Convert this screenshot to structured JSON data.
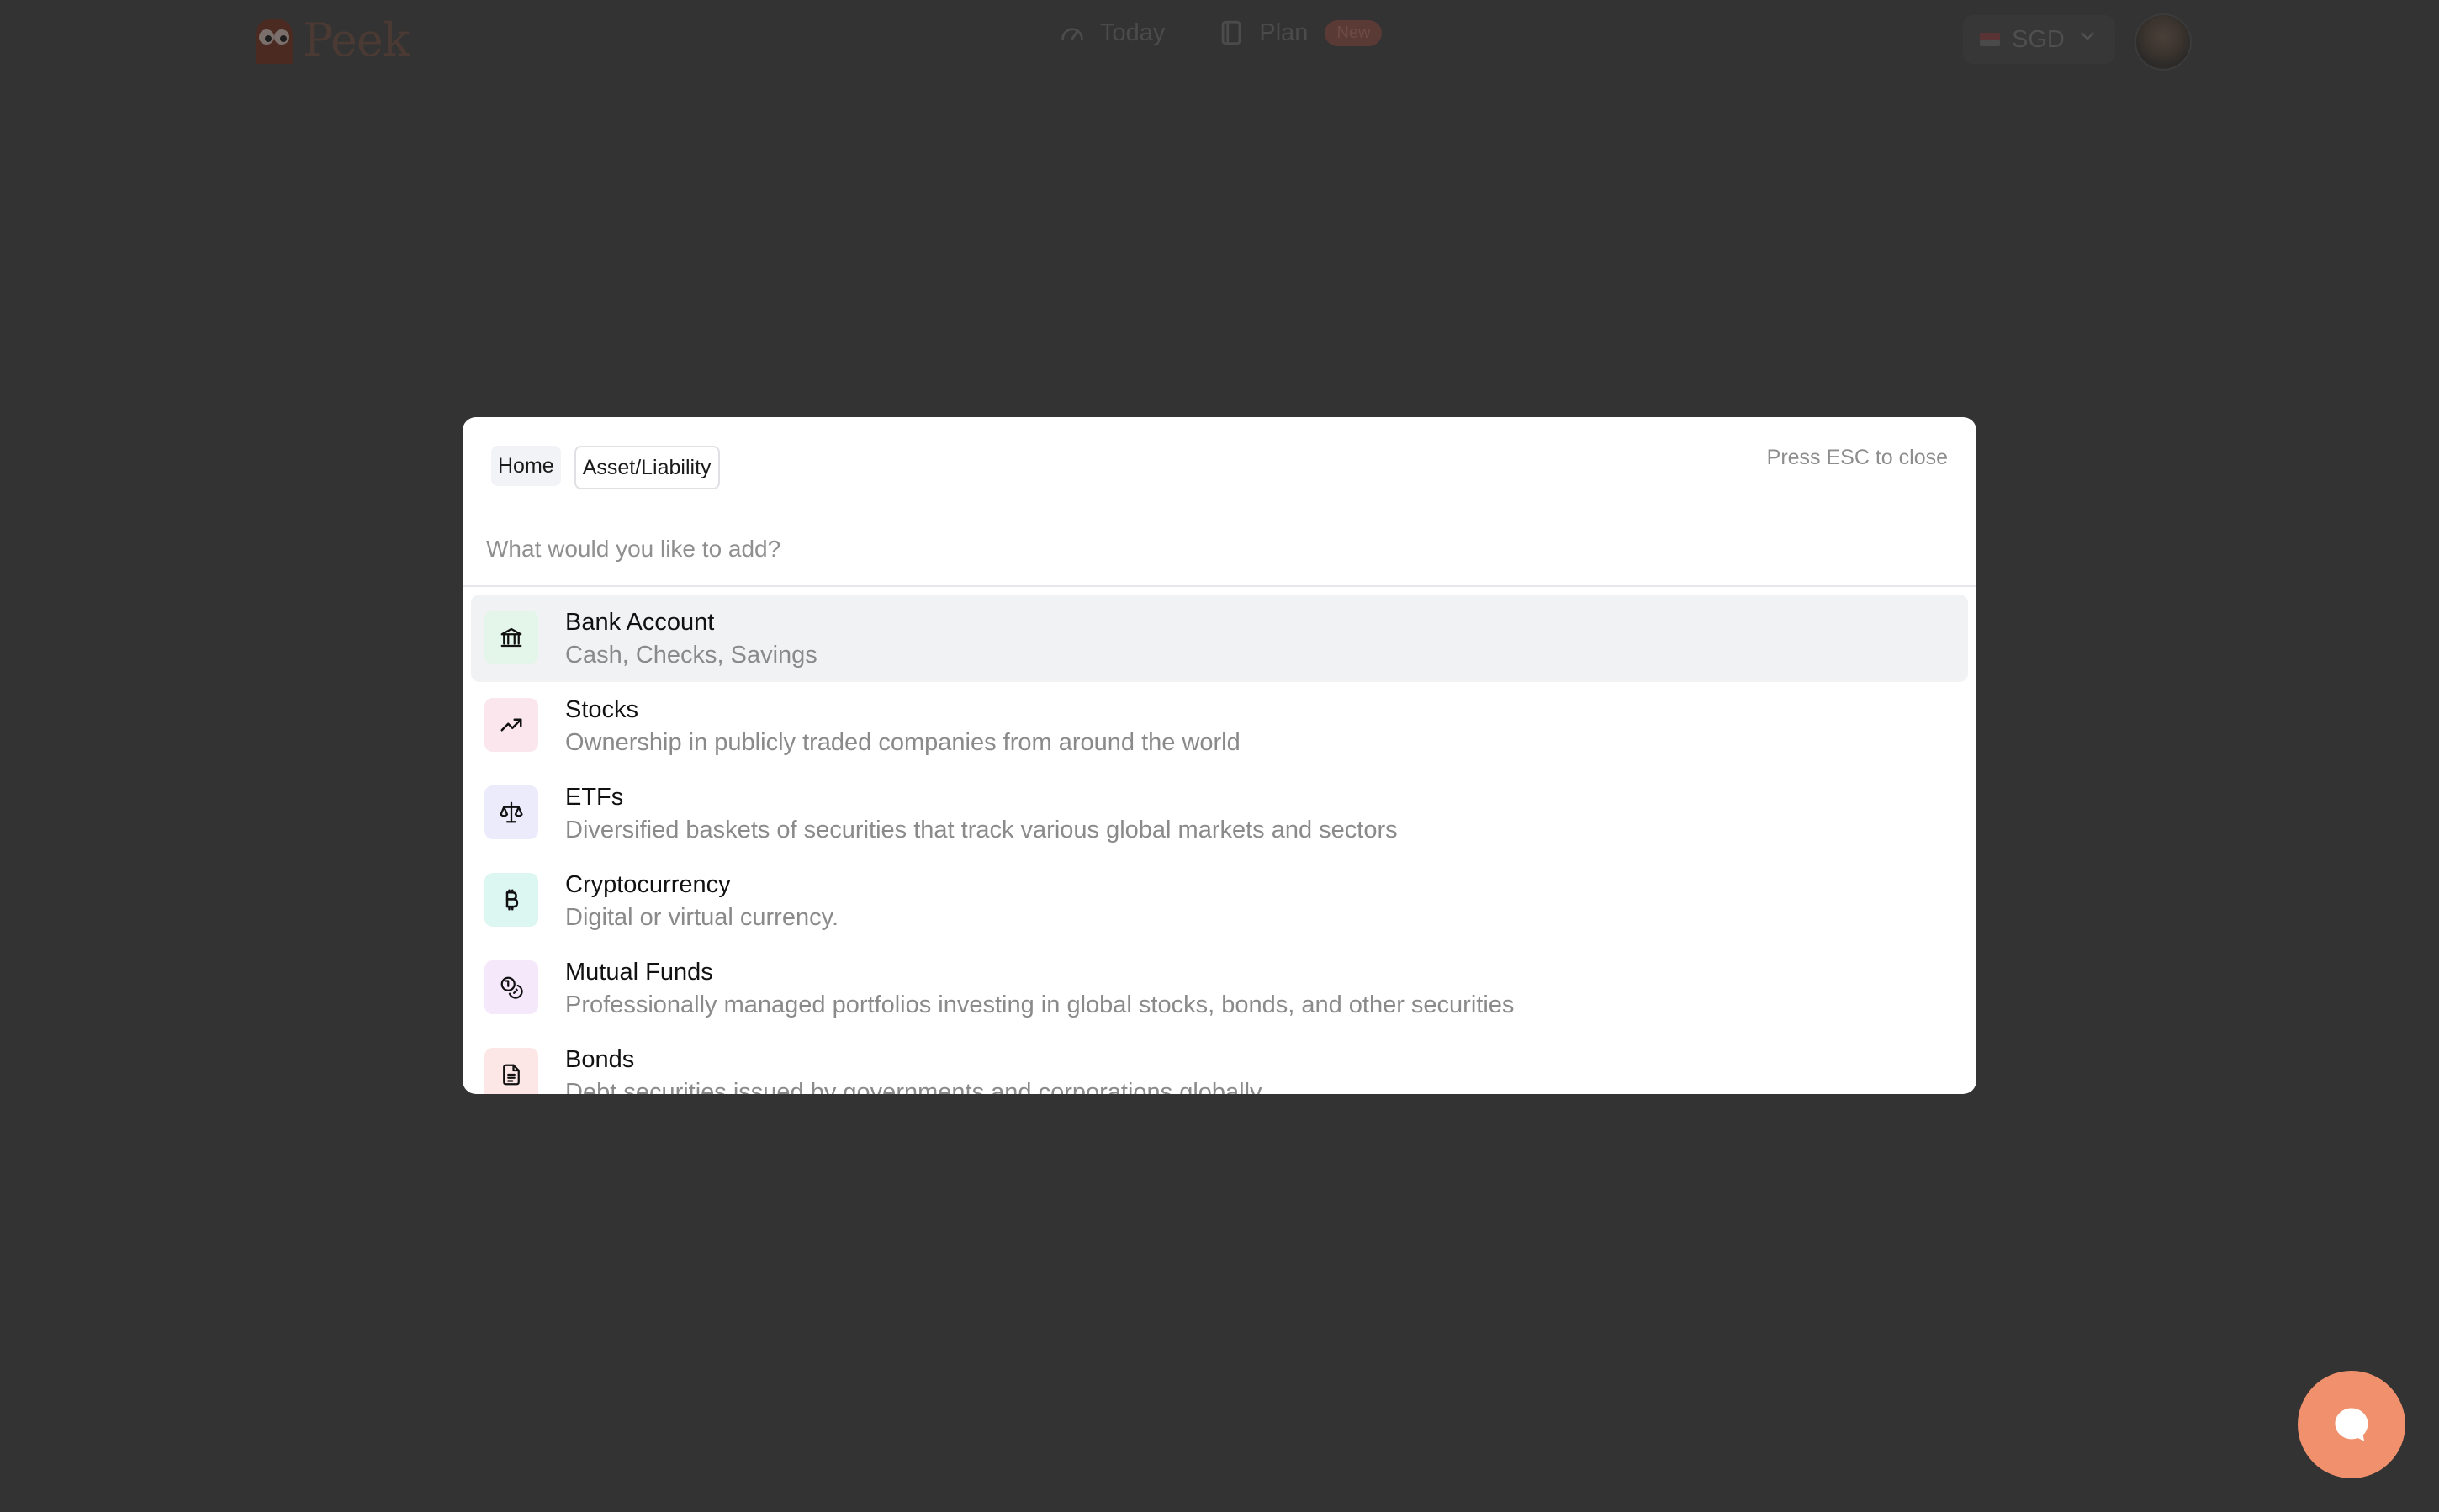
{
  "brand": {
    "name": "Peek"
  },
  "nav": {
    "today_label": "Today",
    "plan_label": "Plan",
    "new_badge": "New"
  },
  "currency": {
    "code": "SGD"
  },
  "modal": {
    "breadcrumbs": [
      "Home",
      "Asset/Liability"
    ],
    "esc_hint": "Press ESC to close",
    "search_placeholder": "What would you like to add?",
    "items": [
      {
        "title": "Bank Account",
        "subtitle": "Cash, Checks, Savings",
        "icon": "bank-icon",
        "icon_bg": "#e4f5ea",
        "selected": true
      },
      {
        "title": "Stocks",
        "subtitle": "Ownership in publicly traded companies from around the world",
        "icon": "trending-up-icon",
        "icon_bg": "#fbe6ee",
        "selected": false
      },
      {
        "title": "ETFs",
        "subtitle": "Diversified baskets of securities that track various global markets and sectors",
        "icon": "scale-icon",
        "icon_bg": "#ecebfc",
        "selected": false
      },
      {
        "title": "Cryptocurrency",
        "subtitle": "Digital or virtual currency.",
        "icon": "bitcoin-icon",
        "icon_bg": "#dcf6f1",
        "selected": false
      },
      {
        "title": "Mutual Funds",
        "subtitle": "Professionally managed portfolios investing in global stocks, bonds, and other securities",
        "icon": "coins-icon",
        "icon_bg": "#f6e8fb",
        "selected": false
      },
      {
        "title": "Bonds",
        "subtitle": "Debt securities issued by governments and corporations globally",
        "icon": "document-icon",
        "icon_bg": "#fde6e6",
        "selected": false
      }
    ]
  },
  "colors": {
    "overlay": "#333333",
    "chat_button": "#f0906c",
    "selected_row": "#f1f2f4"
  },
  "chat": {
    "icon": "chat-bubble-icon"
  }
}
